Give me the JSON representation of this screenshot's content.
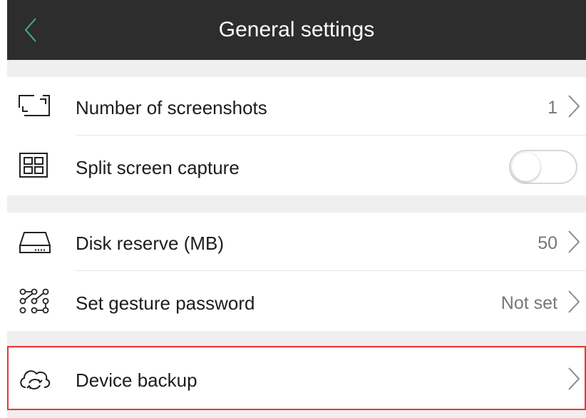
{
  "header": {
    "title": "General settings",
    "back_icon": "chevron-left-icon"
  },
  "colors": {
    "header_bg": "#2d2d2d",
    "back_accent": "#3fb37f",
    "highlight": "#e53935",
    "section_bg": "#efefef"
  },
  "settings": {
    "screenshots": {
      "label": "Number of screenshots",
      "value": "1",
      "icon": "screenshot-frame-icon"
    },
    "split_capture": {
      "label": "Split screen capture",
      "icon": "grid-icon",
      "enabled": false
    },
    "disk_reserve": {
      "label": "Disk reserve (MB)",
      "value": "50",
      "icon": "disk-icon"
    },
    "gesture_password": {
      "label": "Set gesture password",
      "value": "Not set",
      "icon": "gesture-pattern-icon"
    },
    "device_backup": {
      "label": "Device backup",
      "icon": "cloud-sync-icon"
    }
  }
}
